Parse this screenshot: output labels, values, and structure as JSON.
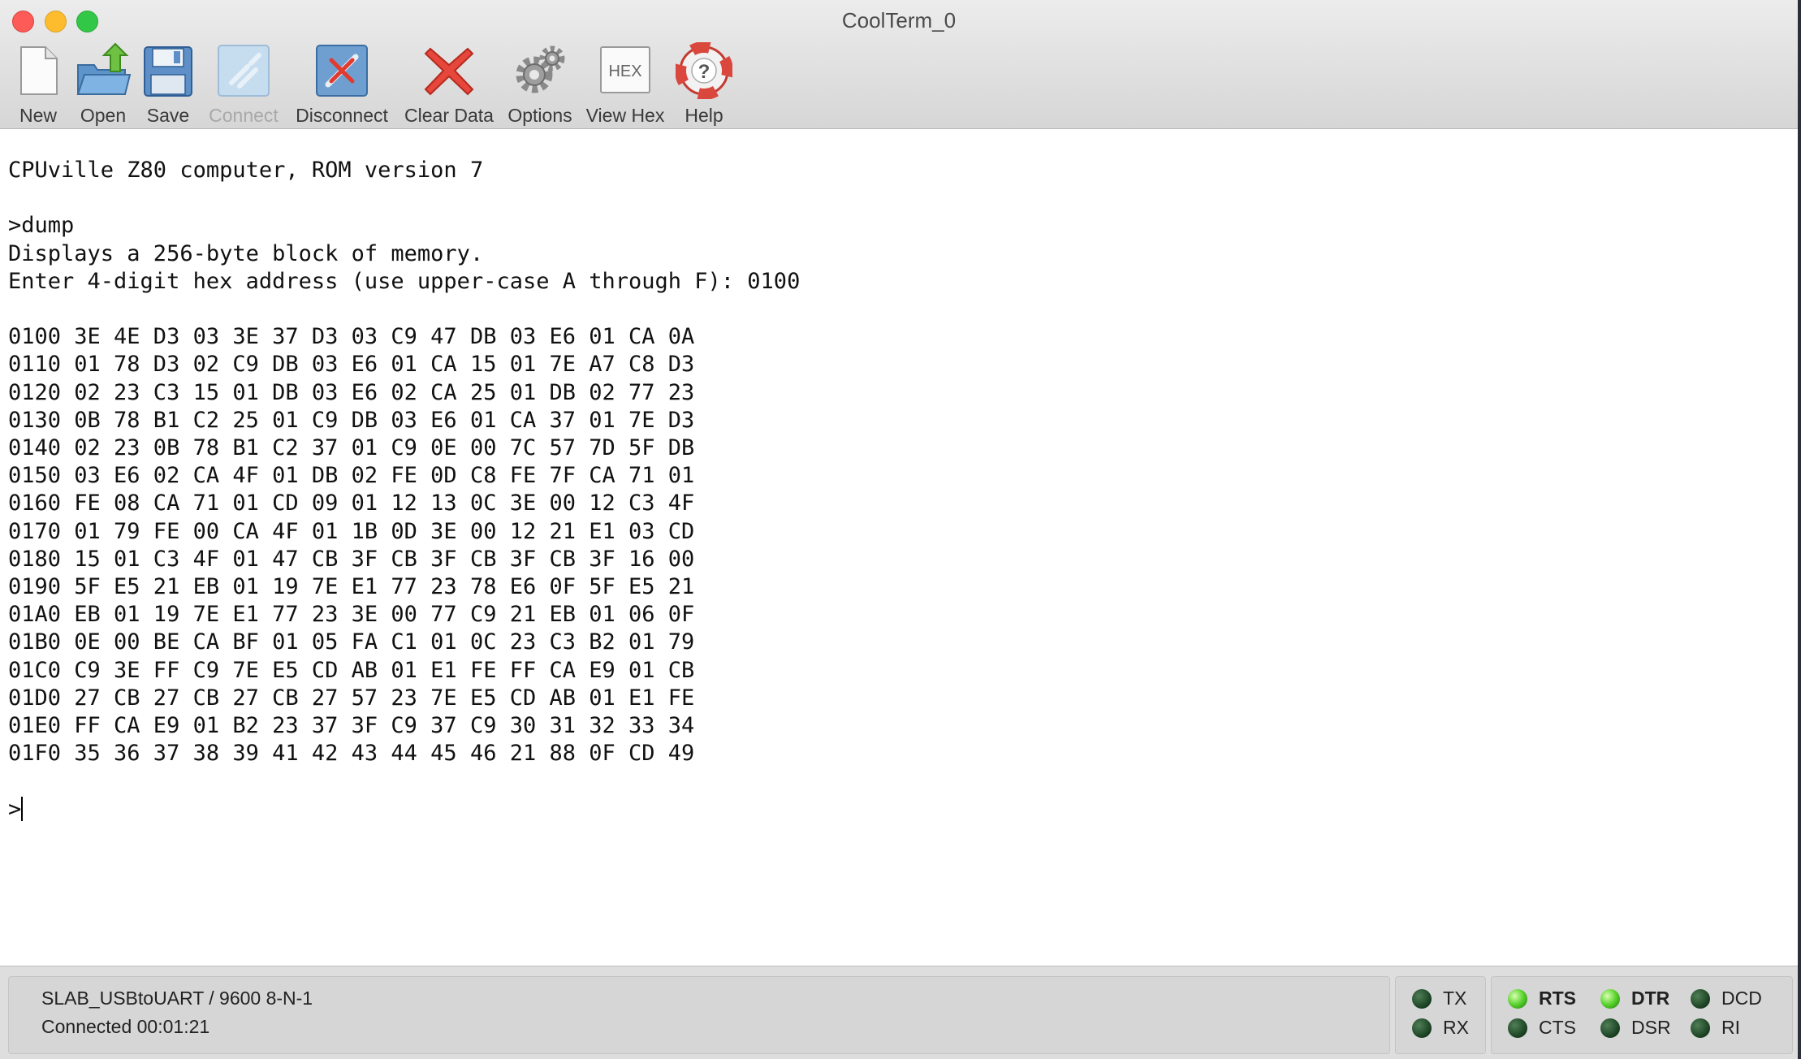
{
  "window": {
    "title": "CoolTerm_0"
  },
  "toolbar": {
    "new_label": "New",
    "open_label": "Open",
    "save_label": "Save",
    "connect_label": "Connect",
    "disconnect_label": "Disconnect",
    "clear_label": "Clear Data",
    "options_label": "Options",
    "viewhex_label": "View Hex",
    "viewhex_icon_text": "HEX",
    "help_label": "Help"
  },
  "terminal": {
    "lines": [
      "CPUville Z80 computer, ROM version 7",
      "",
      ">dump",
      "Displays a 256-byte block of memory.",
      "Enter 4-digit hex address (use upper-case A through F): 0100",
      "",
      "0100 3E 4E D3 03 3E 37 D3 03 C9 47 DB 03 E6 01 CA 0A",
      "0110 01 78 D3 02 C9 DB 03 E6 01 CA 15 01 7E A7 C8 D3",
      "0120 02 23 C3 15 01 DB 03 E6 02 CA 25 01 DB 02 77 23",
      "0130 0B 78 B1 C2 25 01 C9 DB 03 E6 01 CA 37 01 7E D3",
      "0140 02 23 0B 78 B1 C2 37 01 C9 0E 00 7C 57 7D 5F DB",
      "0150 03 E6 02 CA 4F 01 DB 02 FE 0D C8 FE 7F CA 71 01",
      "0160 FE 08 CA 71 01 CD 09 01 12 13 0C 3E 00 12 C3 4F",
      "0170 01 79 FE 00 CA 4F 01 1B 0D 3E 00 12 21 E1 03 CD",
      "0180 15 01 C3 4F 01 47 CB 3F CB 3F CB 3F CB 3F 16 00",
      "0190 5F E5 21 EB 01 19 7E E1 77 23 78 E6 0F 5F E5 21",
      "01A0 EB 01 19 7E E1 77 23 3E 00 77 C9 21 EB 01 06 0F",
      "01B0 0E 00 BE CA BF 01 05 FA C1 01 0C 23 C3 B2 01 79",
      "01C0 C9 3E FF C9 7E E5 CD AB 01 E1 FE FF CA E9 01 CB",
      "01D0 27 CB 27 CB 27 CB 27 57 23 7E E5 CD AB 01 E1 FE",
      "01E0 FF CA E9 01 B2 23 37 3F C9 37 C9 30 31 32 33 34",
      "01F0 35 36 37 38 39 41 42 43 44 45 46 21 88 0F CD 49",
      ""
    ],
    "prompt": ">"
  },
  "status": {
    "port": "SLAB_USBtoUART / 9600 8-N-1",
    "connection": "Connected 00:01:21",
    "tx": "TX",
    "rx": "RX",
    "rts": "RTS",
    "cts": "CTS",
    "dtr": "DTR",
    "dsr": "DSR",
    "dcd": "DCD",
    "ri": "RI"
  }
}
